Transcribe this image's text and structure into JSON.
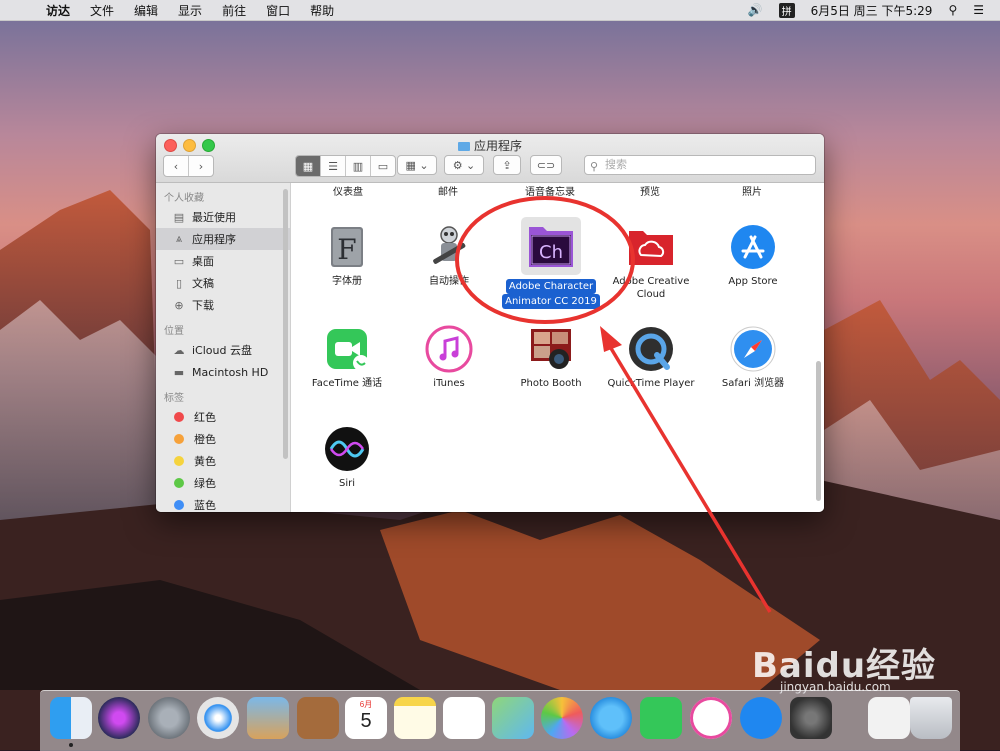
{
  "menubar": {
    "apple_glyph": "",
    "app_name": "访达",
    "items": [
      "文件",
      "编辑",
      "显示",
      "前往",
      "窗口",
      "帮助"
    ],
    "ime": "拼",
    "datetime": "6月5日 周三 下午5:29"
  },
  "window": {
    "title": "应用程序",
    "search_placeholder": "搜索"
  },
  "sidebar": {
    "favorites_heading": "个人收藏",
    "favorites": [
      {
        "label": "最近使用",
        "icon": "recents-icon"
      },
      {
        "label": "应用程序",
        "icon": "applications-icon",
        "selected": true
      },
      {
        "label": "桌面",
        "icon": "desktop-icon"
      },
      {
        "label": "文稿",
        "icon": "documents-icon"
      },
      {
        "label": "下载",
        "icon": "downloads-icon"
      }
    ],
    "locations_heading": "位置",
    "locations": [
      {
        "label": "iCloud 云盘",
        "icon": "cloud-icon"
      },
      {
        "label": "Macintosh HD",
        "icon": "disk-icon"
      }
    ],
    "tags_heading": "标签",
    "tags": [
      {
        "label": "红色",
        "color": "#f0494b"
      },
      {
        "label": "橙色",
        "color": "#f6a13a"
      },
      {
        "label": "黄色",
        "color": "#f5d33d"
      },
      {
        "label": "绿色",
        "color": "#5dc846"
      },
      {
        "label": "蓝色",
        "color": "#3f8ef6"
      }
    ]
  },
  "content": {
    "top_row": [
      "仪表盘",
      "邮件",
      "语音备忘录",
      "预览",
      "照片"
    ],
    "row1": [
      "字体册",
      "自动操作",
      "Adobe Character Animator CC 2019",
      "Adobe Creative Cloud",
      "App Store"
    ],
    "selected_label_line1": "Adobe Character",
    "selected_label_line2": "Animator CC 2019",
    "selected_icon_text": "Ch",
    "font_icon_text": "F",
    "row2": [
      "FaceTime 通话",
      "iTunes",
      "Photo Booth",
      "QuickTime Player",
      "Safari 浏览器"
    ],
    "row3": [
      "Siri"
    ]
  },
  "dock": {
    "calendar_month": "6月",
    "calendar_day": "5"
  },
  "watermark": {
    "text": "Baidu经验",
    "url": "jingyan.baidu.com"
  },
  "colors": {
    "accent": "#1b61d0",
    "annotation": "#e8332f"
  }
}
